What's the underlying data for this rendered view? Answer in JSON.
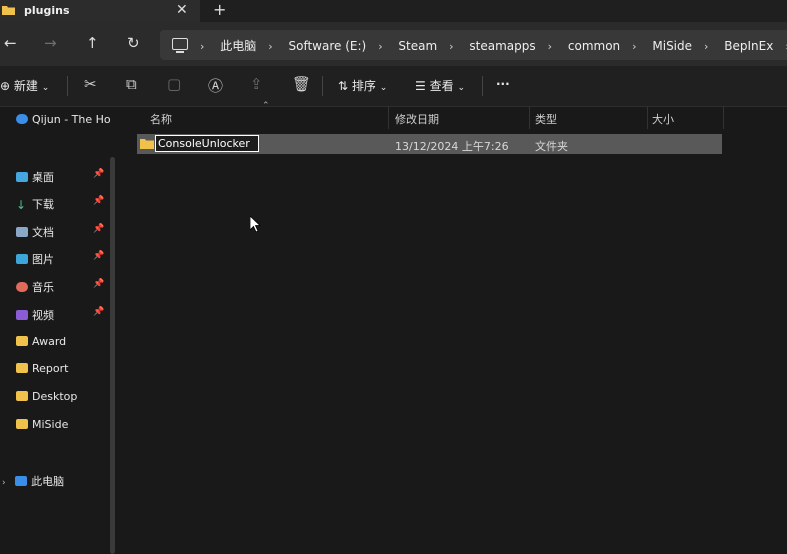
{
  "tab": {
    "title": "plugins",
    "close": "✕",
    "new": "+"
  },
  "nav": {
    "back": "←",
    "forward": "→",
    "up": "↑",
    "refresh": "↻"
  },
  "breadcrumbs": [
    "此电脑",
    "Software (E:)",
    "Steam",
    "steamapps",
    "common",
    "MiSide",
    "BepInEx"
  ],
  "toolbar": {
    "new_label": "新建",
    "sort_label": "排序",
    "view_label": "查看",
    "more": "···"
  },
  "sidebar": {
    "top_item": "Qijun - The Ho",
    "pinned": [
      "桌面",
      "下载",
      "文档",
      "图片",
      "音乐",
      "视频"
    ],
    "folders": [
      "Award",
      "Report",
      "Desktop",
      "MiSide"
    ],
    "this_pc": "此电脑"
  },
  "columns": {
    "name": "名称",
    "date": "修改日期",
    "type": "类型",
    "size": "大小"
  },
  "files": [
    {
      "name": "ConsoleUnlocker",
      "date": "13/12/2024 上午7:26",
      "type": "文件夹",
      "size": ""
    }
  ],
  "colors": {
    "folder": "#f0c14b",
    "accent": "#4ea3ff",
    "selected_row": "#595959"
  }
}
